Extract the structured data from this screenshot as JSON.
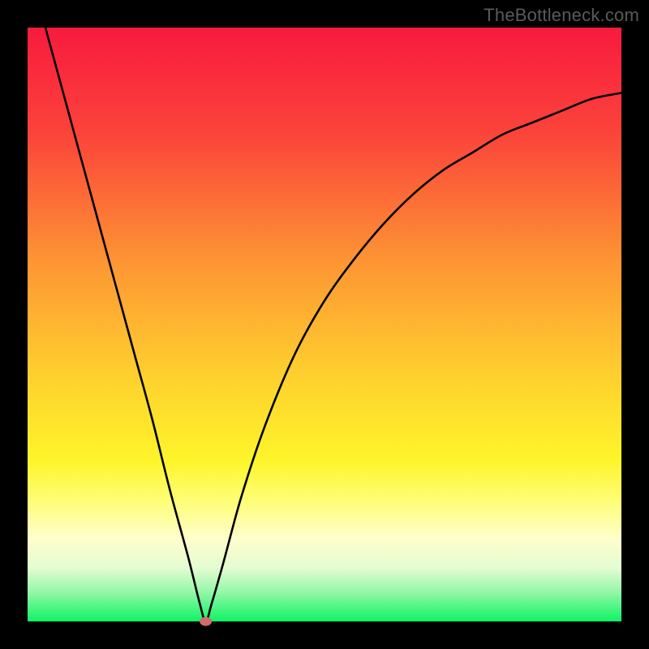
{
  "watermark": "TheBottleneck.com",
  "colors": {
    "frame": "#000000",
    "gradient_stops": [
      {
        "pct": 0,
        "color": "#f81a3e"
      },
      {
        "pct": 18,
        "color": "#fb443a"
      },
      {
        "pct": 40,
        "color": "#fd9733"
      },
      {
        "pct": 58,
        "color": "#fece2e"
      },
      {
        "pct": 73,
        "color": "#fef52a"
      },
      {
        "pct": 80,
        "color": "#fefe7a"
      },
      {
        "pct": 86,
        "color": "#fefecb"
      },
      {
        "pct": 91,
        "color": "#e4fcd2"
      },
      {
        "pct": 95,
        "color": "#95f7a8"
      },
      {
        "pct": 100,
        "color": "#0ef463"
      }
    ],
    "curve": "#000000",
    "marker": "#d46a6a"
  },
  "chart_data": {
    "type": "line",
    "title": "",
    "xlabel": "",
    "ylabel": "",
    "xlim": [
      0,
      100
    ],
    "ylim": [
      0,
      100
    ],
    "grid": false,
    "legend": false,
    "series": [
      {
        "name": "curve",
        "x": [
          3,
          6,
          9,
          12,
          15,
          18,
          21,
          24,
          27,
          29,
          30,
          31,
          33,
          36,
          40,
          45,
          50,
          55,
          60,
          65,
          70,
          75,
          80,
          85,
          90,
          95,
          100
        ],
        "values": [
          100,
          89,
          78,
          67,
          56,
          45,
          34,
          22,
          11,
          3,
          0,
          3,
          10,
          21,
          33,
          45,
          54,
          61,
          67,
          72,
          76,
          79,
          82,
          84,
          86,
          88,
          89
        ]
      }
    ],
    "marker": {
      "x": 30,
      "y": 0
    }
  }
}
